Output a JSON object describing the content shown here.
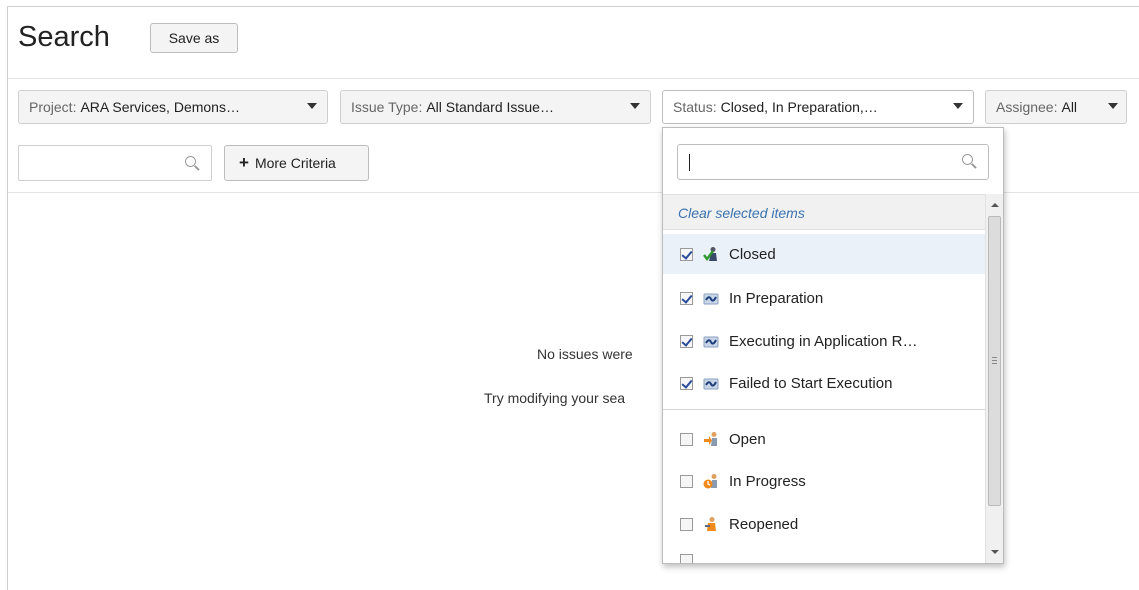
{
  "header": {
    "title": "Search",
    "save_as_label": "Save as"
  },
  "criteria": {
    "project": {
      "key": "Project:",
      "value": "ARA Services, Demons…"
    },
    "issue_type": {
      "key": "Issue Type:",
      "value": "All Standard Issue…"
    },
    "status": {
      "key": "Status:",
      "value": "Closed, In Preparation,…"
    },
    "assignee": {
      "key": "Assignee:",
      "value": "All"
    },
    "text_search_value": "",
    "more_criteria_label": "More Criteria"
  },
  "results": {
    "message_line1": "No issues were",
    "message_line2": "Try modifying your sea"
  },
  "status_dropdown": {
    "search_value": "",
    "clear_label": "Clear selected items",
    "options": [
      {
        "label": "Closed",
        "checked": true,
        "icon": "closed-status-icon"
      },
      {
        "label": "In Preparation",
        "checked": true,
        "icon": "workflow-status-icon"
      },
      {
        "label": "Executing in Application R…",
        "checked": true,
        "icon": "workflow-status-icon"
      },
      {
        "label": "Failed to Start Execution",
        "checked": true,
        "icon": "workflow-status-icon"
      },
      {
        "label": "Open",
        "checked": false,
        "icon": "open-status-icon"
      },
      {
        "label": "In Progress",
        "checked": false,
        "icon": "in-progress-status-icon"
      },
      {
        "label": "Reopened",
        "checked": false,
        "icon": "reopened-status-icon"
      }
    ]
  },
  "colors": {
    "link": "#3b73af",
    "highlight": "#eaf1f8"
  }
}
